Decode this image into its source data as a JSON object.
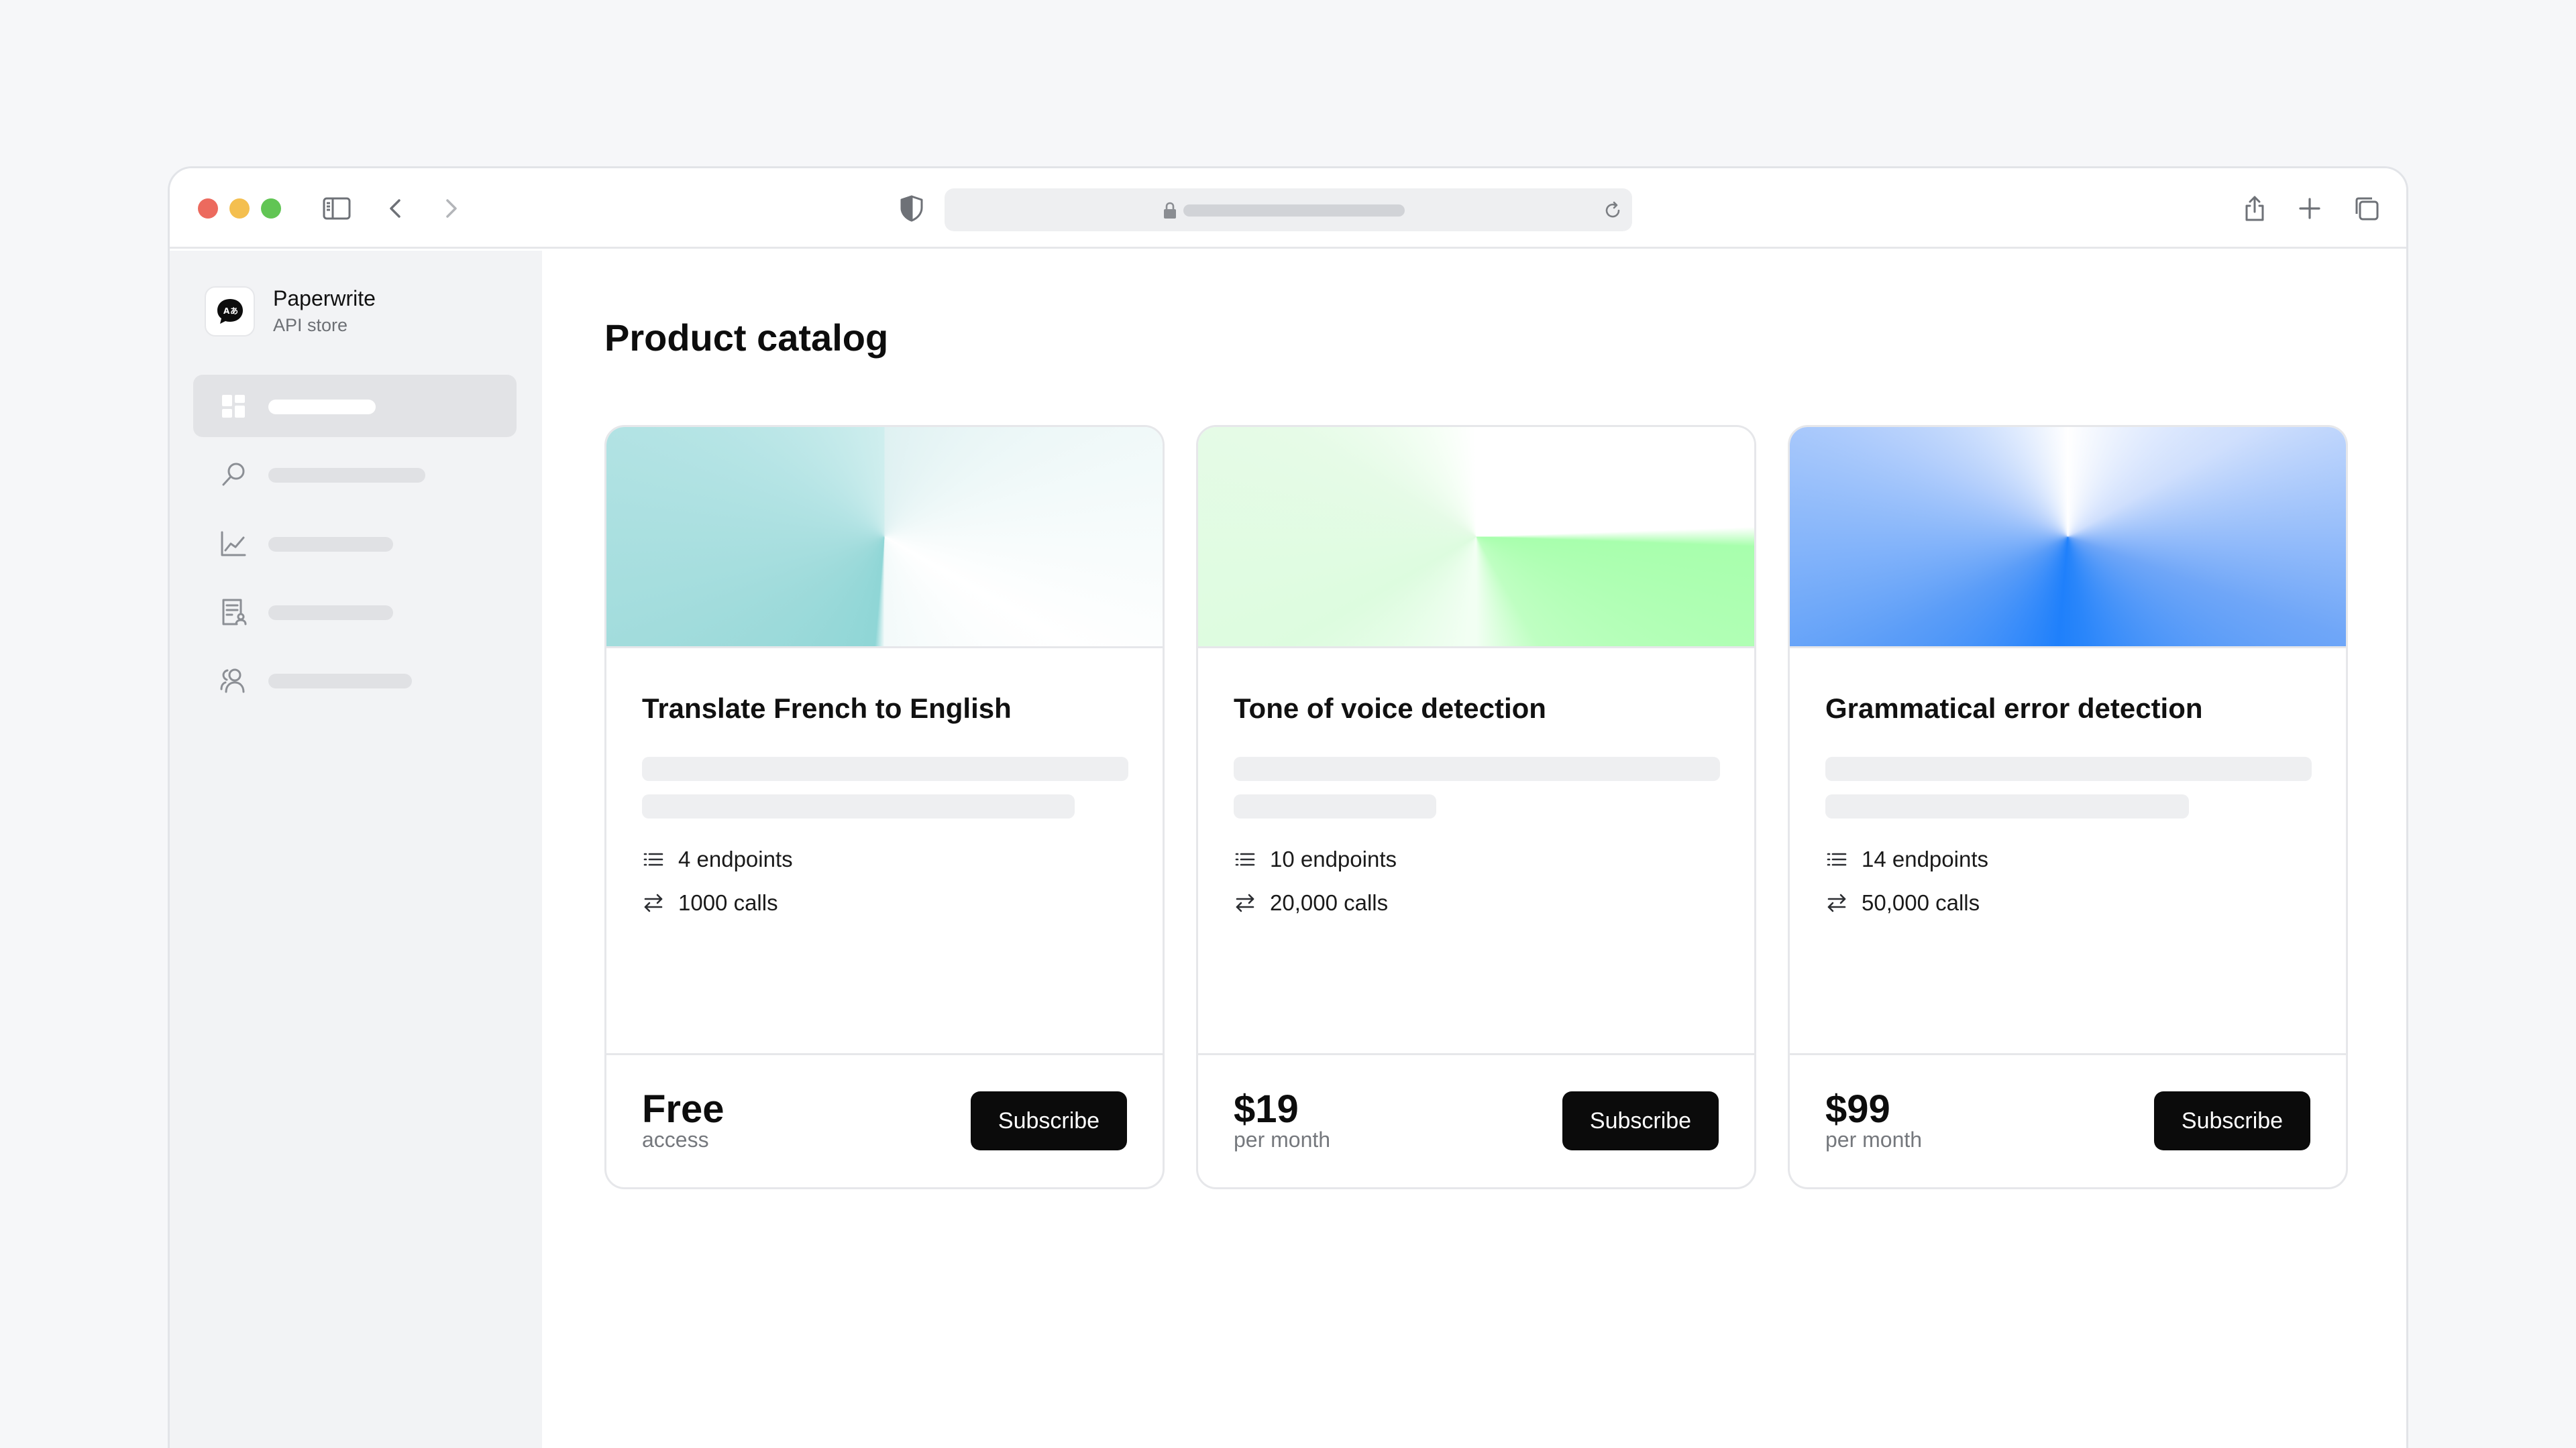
{
  "browser": {
    "controls": [
      "close",
      "minimize",
      "maximize"
    ],
    "icons": [
      "sidebar-toggle-icon",
      "back-chevron-icon",
      "forward-chevron-icon",
      "shield-icon",
      "lock-icon",
      "reload-icon",
      "share-icon",
      "new-tab-plus-icon",
      "tabs-overview-icon"
    ]
  },
  "sidebar": {
    "brand_name": "Paperwrite",
    "brand_subtitle": "API store",
    "items": [
      {
        "icon": "dashboard-icon",
        "active": true
      },
      {
        "icon": "search-icon",
        "active": false
      },
      {
        "icon": "chart-icon",
        "active": false
      },
      {
        "icon": "invoice-icon",
        "active": false
      },
      {
        "icon": "users-icon",
        "active": false
      }
    ]
  },
  "main": {
    "title": "Product catalog",
    "cards": [
      {
        "title": "Translate French to English",
        "endpoints": "4 endpoints",
        "calls": "1000 calls",
        "price": "Free",
        "price_sub": "access",
        "button": "Subscribe",
        "hero_color": "#8fd6d6"
      },
      {
        "title": "Tone of voice detection",
        "endpoints": "10 endpoints",
        "calls": "20,000 calls",
        "price": "$19",
        "price_sub": "per month",
        "button": "Subscribe",
        "hero_color": "#a8ffad"
      },
      {
        "title": "Grammatical error detection",
        "endpoints": "14 endpoints",
        "calls": "50,000 calls",
        "price": "$99",
        "price_sub": "per month",
        "button": "Subscribe",
        "hero_color": "#1f80fb"
      }
    ]
  }
}
